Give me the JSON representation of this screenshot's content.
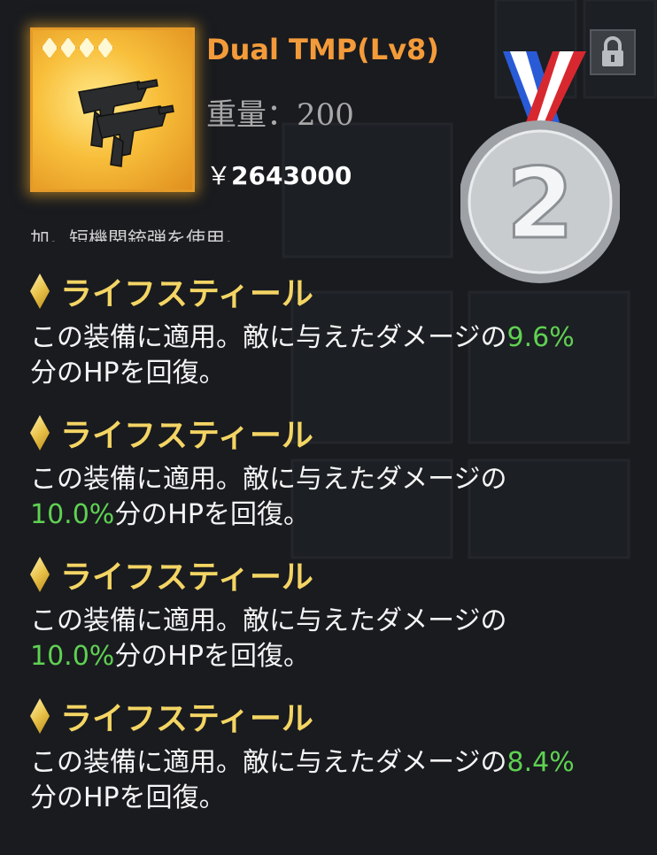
{
  "item": {
    "name": "Dual TMP(Lv8)",
    "weight": "重量：200",
    "price_symbol": "￥",
    "price_value": "2643000",
    "star_count": 4,
    "rarity_color": "#f8bf3b"
  },
  "medal": {
    "number": "2",
    "icon": "silver-medal-icon"
  },
  "lock": {
    "icon": "lock-icon"
  },
  "cut_text": "加。短機関銃弾を使用。",
  "effects": [
    {
      "name": "ライフスティール",
      "desc_pre": "この装備に適用。敵に与えたダメージの",
      "pct": "9.6%",
      "desc_post": "分のHPを回復。"
    },
    {
      "name": "ライフスティール",
      "desc_pre": "この装備に適用。敵に与えたダメージの",
      "pct": "10.0%",
      "desc_post": "分のHPを回復。"
    },
    {
      "name": "ライフスティール",
      "desc_pre": "この装備に適用。敵に与えたダメージの",
      "pct": "10.0%",
      "desc_post": "分のHPを回復。"
    },
    {
      "name": "ライフスティール",
      "desc_pre": "この装備に適用。敵に与えたダメージの",
      "pct": "8.4%",
      "desc_post": "分のHPを回復。"
    }
  ],
  "colors": {
    "effect_title": "#f4d564",
    "percent": "#5fd152",
    "item_name": "#f39b3a"
  }
}
